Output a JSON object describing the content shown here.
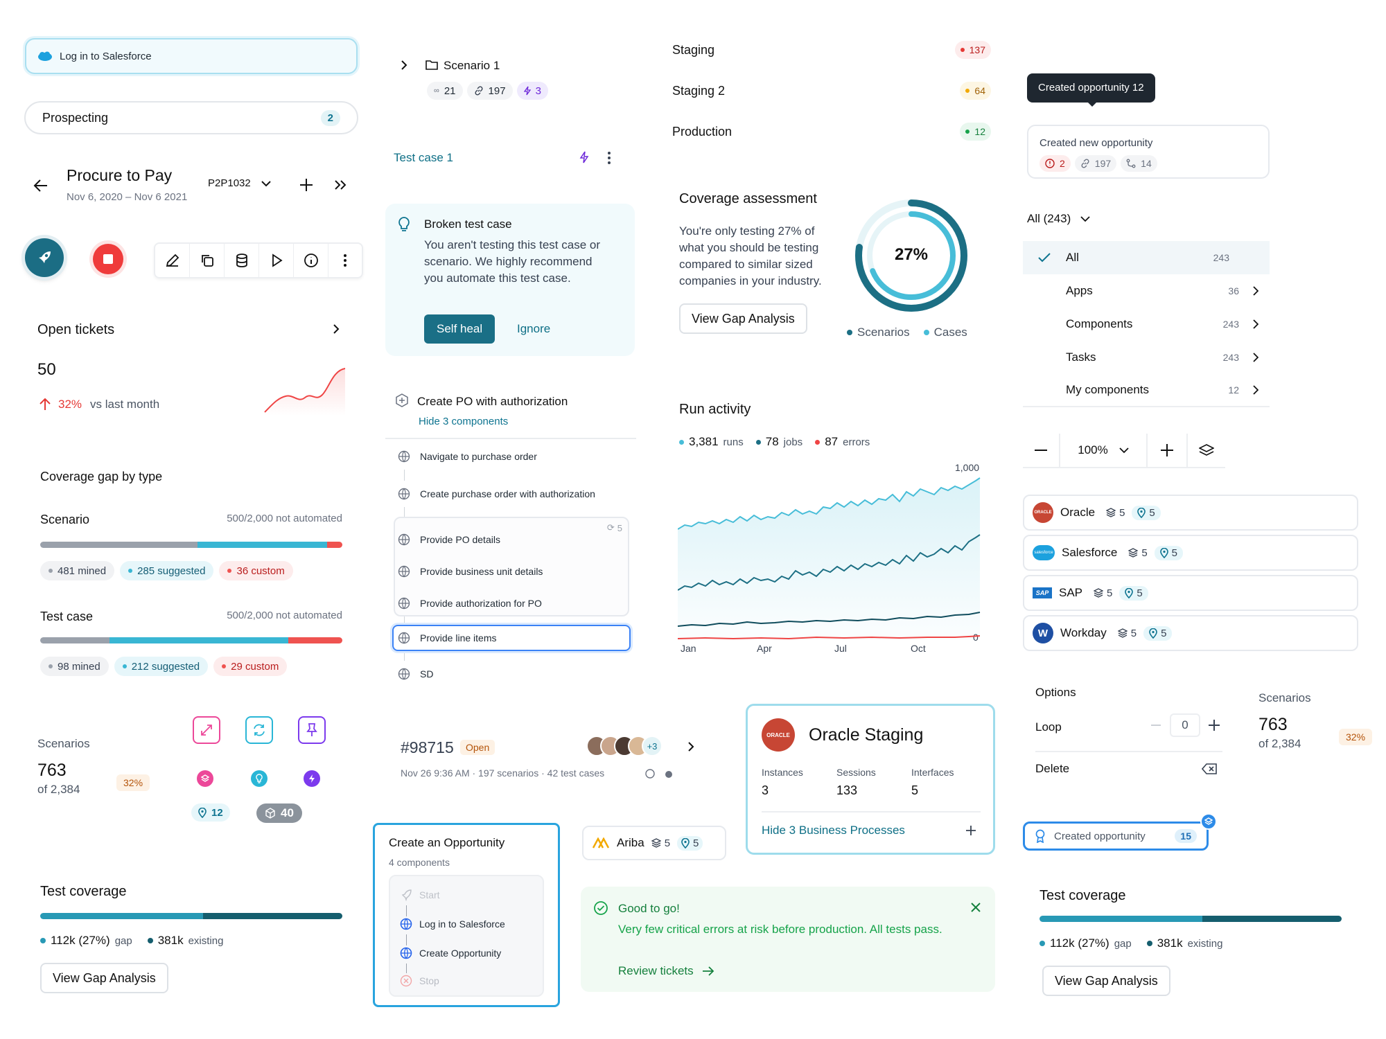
{
  "col1": {
    "login_pill": "Log in to Salesforce",
    "prospecting": {
      "label": "Prospecting",
      "count": "2"
    },
    "header": {
      "title": "Procure to Pay",
      "dates": "Nov 6, 2020 – Nov 6 2021",
      "code": "P2P1032"
    },
    "open_tickets": {
      "title": "Open tickets",
      "value": "50",
      "change": "32%",
      "vs": "vs last month"
    },
    "coverage_gap": {
      "title": "Coverage gap by type",
      "scenario": {
        "label": "Scenario",
        "status": "500/2,000 not automated",
        "mined": "481 mined",
        "suggested": "285 suggested",
        "custom": "36 custom"
      },
      "testcase": {
        "label": "Test case",
        "status": "500/2,000 not automated",
        "mined": "98 mined",
        "suggested": "212 suggested",
        "custom": "29 custom"
      }
    },
    "scenarios": {
      "label": "Scenarios",
      "value": "763",
      "of": "of 2,384",
      "pct": "32%",
      "pins": "12",
      "boxes": "40"
    },
    "test_coverage": {
      "title": "Test coverage",
      "gap": "112k (27%)",
      "gap_label": "gap",
      "existing": "381k",
      "existing_label": "existing",
      "button": "View Gap Analysis",
      "gap_fraction": 0.5
    }
  },
  "col2": {
    "scenario1": {
      "title": "Scenario 1",
      "links": "21",
      "chain": "197",
      "bolt": "3"
    },
    "testcase1": "Test case 1",
    "broken": {
      "title": "Broken test case",
      "body": "You aren't testing this test case or scenario. We highly recommend you automate this test case.",
      "primary": "Self heal",
      "secondary": "Ignore"
    },
    "steps": {
      "title": "Create PO with authorization",
      "toggle": "Hide 3 components",
      "items": [
        "Navigate to purchase order",
        "Create purchase order with authorization"
      ],
      "group_count": "5",
      "group": [
        "Provide PO details",
        "Provide business unit details",
        "Provide authorization for PO"
      ],
      "selected": "Provide line items",
      "last": "SD"
    },
    "ticket": {
      "id": "#98715",
      "status": "Open",
      "meta": "Nov 26 9:36 AM · 197 scenarios · 42 test cases",
      "extra": "+3"
    },
    "opportunity": {
      "title": "Create an Opportunity",
      "sub": "4 components",
      "steps": [
        "Start",
        "Log in to Salesforce",
        "Create Opportunity",
        "Stop"
      ]
    },
    "ariba": {
      "name": "Ariba",
      "a": "5",
      "b": "5"
    }
  },
  "col3": {
    "envs": [
      {
        "name": "Staging",
        "count": "137",
        "color": "#e53935"
      },
      {
        "name": "Staging 2",
        "count": "64",
        "color": "#f2a900"
      },
      {
        "name": "Production",
        "count": "12",
        "color": "#16a34a"
      }
    ],
    "coverage_assessment": {
      "title": "Coverage assessment",
      "body": "You're only testing 27% of what you should be testing compared to similar sized companies in your industry.",
      "button": "View Gap Analysis",
      "pct": "27%",
      "legend": [
        "Scenarios",
        "Cases"
      ]
    },
    "run_activity": {
      "title": "Run activity",
      "runs": "3,381",
      "runs_label": "runs",
      "jobs": "78",
      "jobs_label": "jobs",
      "errors": "87",
      "errors_label": "errors",
      "ymax": "1,000",
      "ymin": "0",
      "months": [
        "Jan",
        "Apr",
        "Jul",
        "Oct"
      ]
    },
    "oracle": {
      "name": "Oracle Staging",
      "logo": "ORACLE",
      "stats": [
        {
          "label": "Instances",
          "value": "3"
        },
        {
          "label": "Sessions",
          "value": "133"
        },
        {
          "label": "Interfaces",
          "value": "5"
        }
      ],
      "toggle": "Hide 3 Business Processes"
    },
    "good": {
      "title": "Good to go!",
      "body": "Very few critical errors at risk before production. All tests pass.",
      "link": "Review tickets"
    }
  },
  "col4": {
    "tooltip": "Created opportunity 12",
    "created_new": {
      "title": "Created new opportunity",
      "errors": "2",
      "chain": "197",
      "branch": "14"
    },
    "filter": {
      "label": "All (243)",
      "items": [
        {
          "label": "All",
          "count": "243"
        },
        {
          "label": "Apps",
          "count": "36"
        },
        {
          "label": "Components",
          "count": "243"
        },
        {
          "label": "Tasks",
          "count": "243"
        },
        {
          "label": "My components",
          "count": "12"
        }
      ]
    },
    "zoom": "100%",
    "apps": [
      {
        "name": "Oracle",
        "a": "5",
        "b": "5",
        "logo": "ORACLE"
      },
      {
        "name": "Salesforce",
        "a": "5",
        "b": "5",
        "logo": "salesforce"
      },
      {
        "name": "SAP",
        "a": "5",
        "b": "5",
        "logo": "SAP"
      },
      {
        "name": "Workday",
        "a": "5",
        "b": "5",
        "logo": "W"
      }
    ],
    "options": {
      "title": "Options",
      "loop": "Loop",
      "loop_value": "0",
      "delete": "Delete"
    },
    "scenarios": {
      "label": "Scenarios",
      "value": "763",
      "of": "of 2,384",
      "pct": "32%"
    },
    "created_opp": {
      "label": "Created opportunity",
      "count": "15"
    },
    "test_coverage": {
      "title": "Test coverage",
      "gap": "112k (27%)",
      "gap_label": "gap",
      "existing": "381k",
      "existing_label": "existing",
      "button": "View Gap Analysis"
    }
  }
}
